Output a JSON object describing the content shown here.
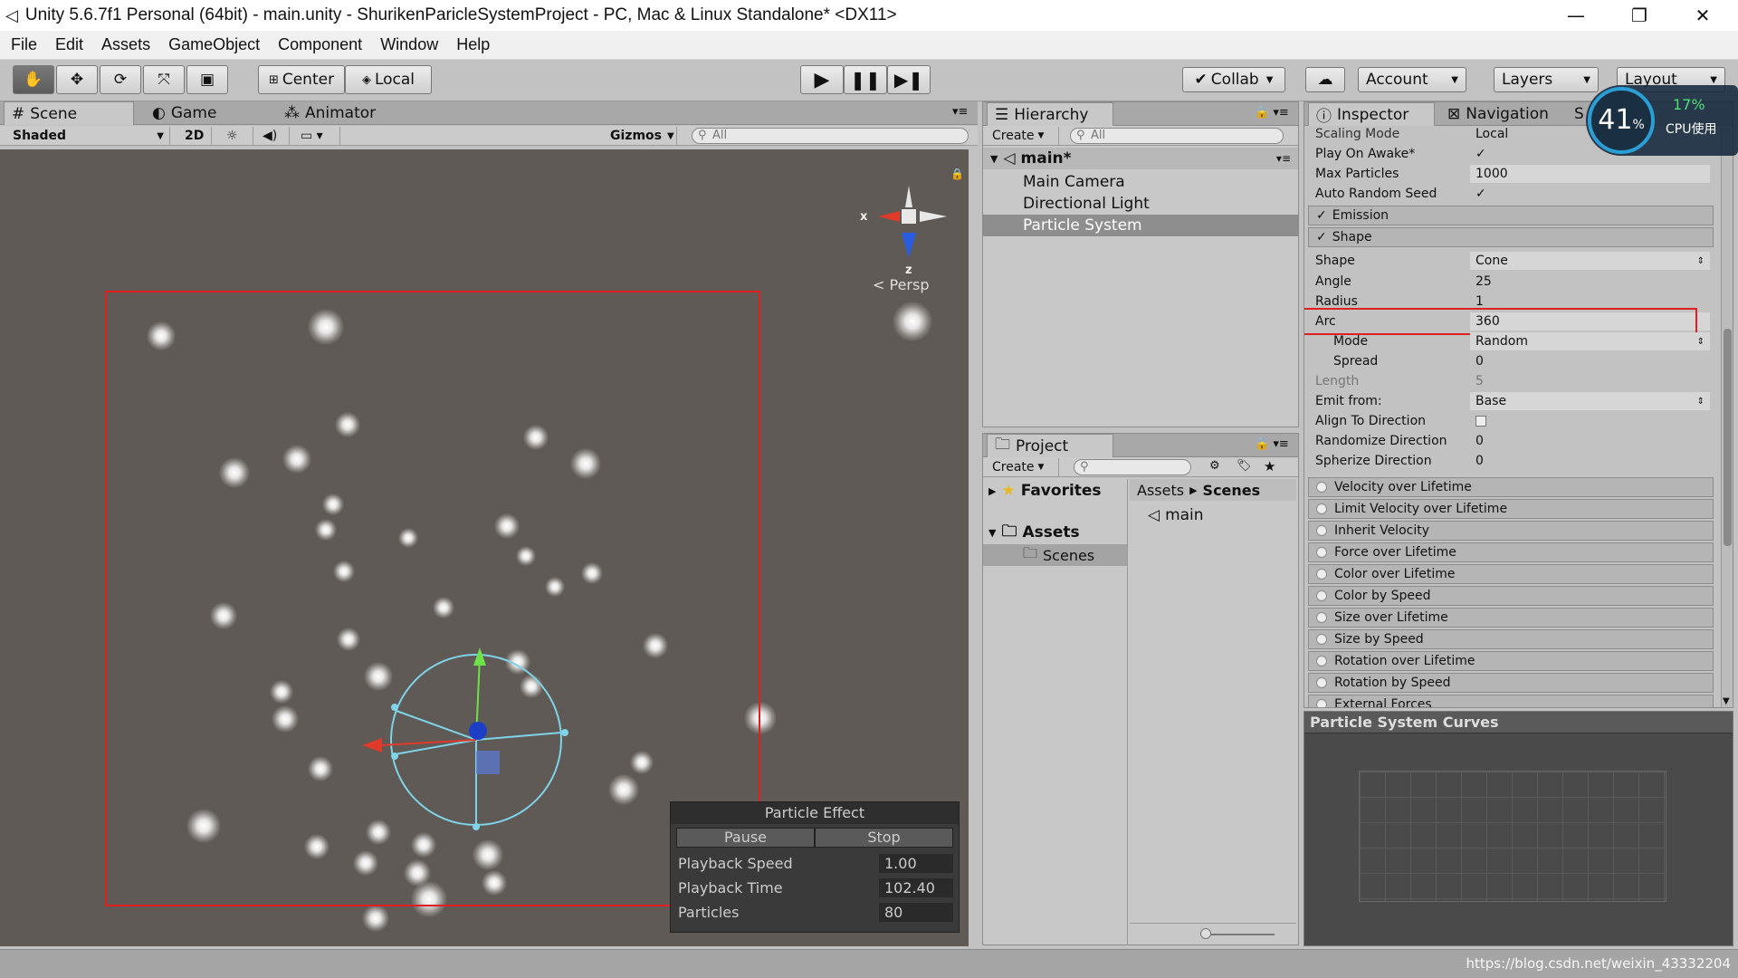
{
  "window": {
    "title": "Unity 5.6.7f1 Personal (64bit) - main.unity - ShurikenParicleSystemProject - PC, Mac & Linux Standalone* <DX11>",
    "controls": [
      "—",
      "❐",
      "✕"
    ]
  },
  "menu": [
    "File",
    "Edit",
    "Assets",
    "GameObject",
    "Component",
    "Window",
    "Help"
  ],
  "toolbar": {
    "pivot": "Center",
    "space": "Local",
    "collab": "Collab",
    "account": "Account",
    "layers": "Layers",
    "layout": "Layout"
  },
  "scene_panel": {
    "tabs": [
      "Scene",
      "Game",
      "Animator"
    ],
    "shading": "Shaded",
    "mode_2d": "2D",
    "gizmos": "Gizmos",
    "search_placeholder": "All",
    "persp": "Persp",
    "axis_x": "x",
    "axis_z": "z"
  },
  "particle_effect": {
    "title": "Particle Effect",
    "pause": "Pause",
    "stop": "Stop",
    "rows": [
      {
        "label": "Playback Speed",
        "value": "1.00"
      },
      {
        "label": "Playback Time",
        "value": "102.40"
      },
      {
        "label": "Particles",
        "value": "80"
      }
    ]
  },
  "hierarchy": {
    "tab": "Hierarchy",
    "create": "Create",
    "search_placeholder": "All",
    "scene": "main*",
    "items": [
      "Main Camera",
      "Directional Light",
      "Particle System"
    ],
    "selected": "Particle System"
  },
  "project": {
    "tab": "Project",
    "create": "Create",
    "favorites": "Favorites",
    "assets": "Assets",
    "scenes": "Scenes",
    "breadcrumb": [
      "Assets",
      "Scenes"
    ],
    "files": [
      "main"
    ]
  },
  "inspector": {
    "tabs": [
      "Inspector",
      "Navigation",
      "S"
    ],
    "main_rows": [
      {
        "label": "Scaling Mode",
        "value": "Local"
      },
      {
        "label": "Play On Awake*",
        "value": "✓"
      },
      {
        "label": "Max Particles",
        "value": "1000"
      },
      {
        "label": "Auto Random Seed",
        "value": "✓"
      }
    ],
    "emission": "Emission",
    "shape_section": "Shape",
    "shape_rows": [
      {
        "label": "Shape",
        "value": "Cone"
      },
      {
        "label": "Angle",
        "value": "25"
      },
      {
        "label": "Radius",
        "value": "1"
      },
      {
        "label": "Arc",
        "value": "360"
      },
      {
        "label": "Mode",
        "value": "Random"
      },
      {
        "label": "Spread",
        "value": "0"
      },
      {
        "label": "Length",
        "value": "5"
      },
      {
        "label": "Emit from:",
        "value": "Base"
      },
      {
        "label": "Align To Direction",
        "value": ""
      },
      {
        "label": "Randomize Direction",
        "value": "0"
      },
      {
        "label": "Spherize Direction",
        "value": "0"
      }
    ],
    "modules": [
      "Velocity over Lifetime",
      "Limit Velocity over Lifetime",
      "Inherit Velocity",
      "Force over Lifetime",
      "Color over Lifetime",
      "Color by Speed",
      "Size over Lifetime",
      "Size by Speed",
      "Rotation over Lifetime",
      "Rotation by Speed",
      "External Forces"
    ],
    "curves_title": "Particle System Curves"
  },
  "cpu_widget": {
    "percent": "41",
    "unit": "%",
    "usage": "17%",
    "label": "CPU使用"
  },
  "watermark": "https://blog.csdn.net/weixin_43332204",
  "colors": {
    "highlight": "#e02020",
    "scene_bg": "#5f5a55",
    "selection": "#8e8e8e"
  }
}
